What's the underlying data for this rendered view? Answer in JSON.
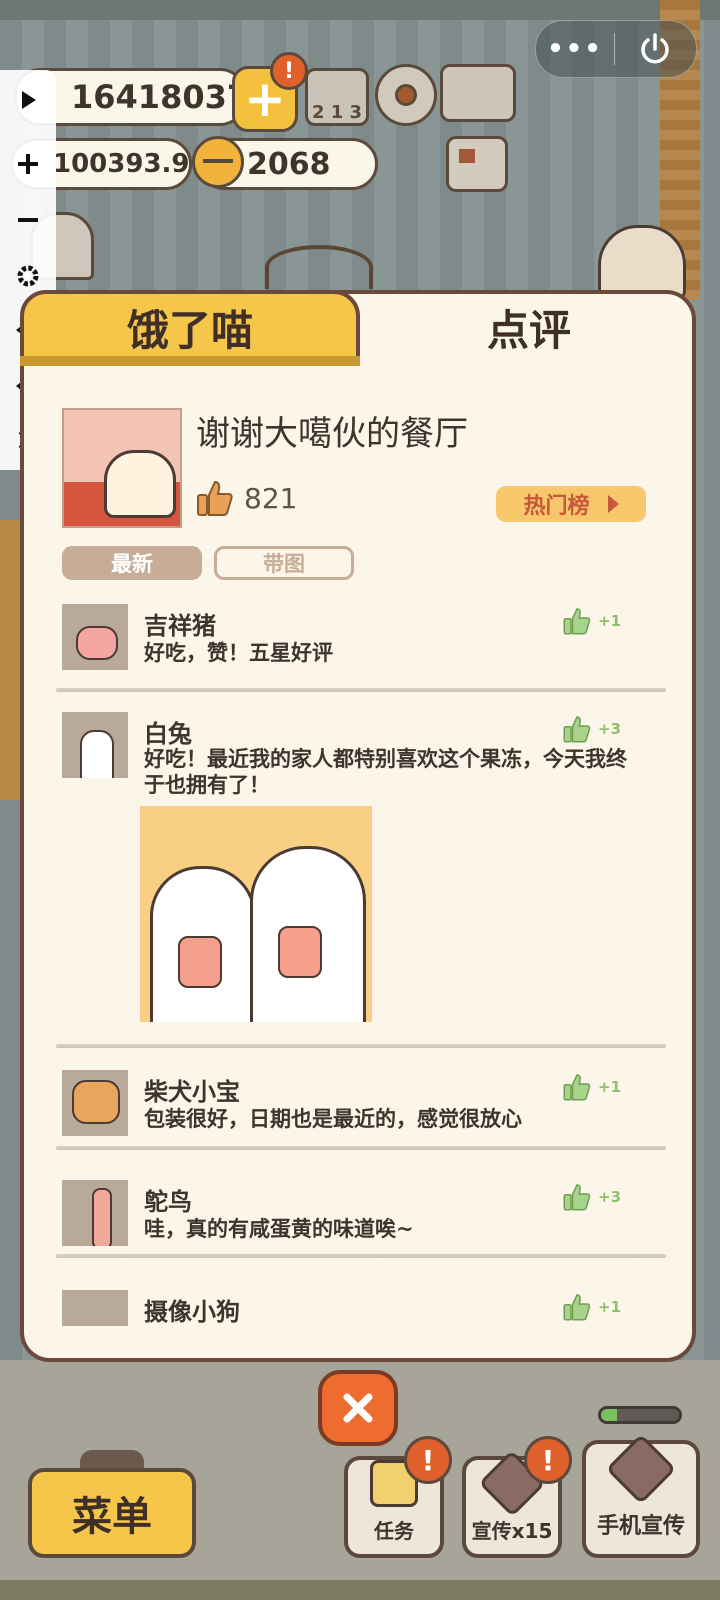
{
  "resources": {
    "money": "16418037",
    "stars": "100393.9",
    "bells": "2068"
  },
  "alerts": {
    "plus": "!",
    "task": "!",
    "promo": "!"
  },
  "rank_icon_text": "2 1 3",
  "tabs": [
    {
      "label": "饿了喵",
      "active": false
    },
    {
      "label": "点评",
      "active": true
    }
  ],
  "restaurant": {
    "name": "谢谢大噶伙的餐厅",
    "likes": "821",
    "hot_button": "热门榜"
  },
  "filters": {
    "newest": "最新",
    "with_image": "带图"
  },
  "reviews": [
    {
      "user": "吉祥猪",
      "text": "好吃，赞！五星好评",
      "likes": "+1",
      "avatar": "pig-avatar"
    },
    {
      "user": "白兔",
      "text": "好吃！最近我的家人都特别喜欢这个果冻，今天我终于也拥有了！",
      "likes": "+3",
      "avatar": "bunny-avatar",
      "has_image": true
    },
    {
      "user": "柴犬小宝",
      "text": "包装很好，日期也是最近的，感觉很放心",
      "likes": "+1",
      "avatar": "shiba-avatar"
    },
    {
      "user": "鸵鸟",
      "text": "哇，真的有咸蛋黄的味道唉~",
      "likes": "+3",
      "avatar": "ostrich-avatar"
    },
    {
      "user": "摄像小狗",
      "text": "",
      "likes": "+1",
      "avatar": "dog-avatar"
    }
  ],
  "bottom": {
    "menu": "菜单",
    "task": "任务",
    "promo": "宣传x15",
    "phone_promo": "手机宣传",
    "progress_fraction": 0.2
  },
  "capsule": {
    "more": "•••"
  },
  "colors": {
    "accent_yellow": "#f6c64b",
    "panel_border": "#6b4a3b",
    "like_green": "#8fc06c"
  }
}
